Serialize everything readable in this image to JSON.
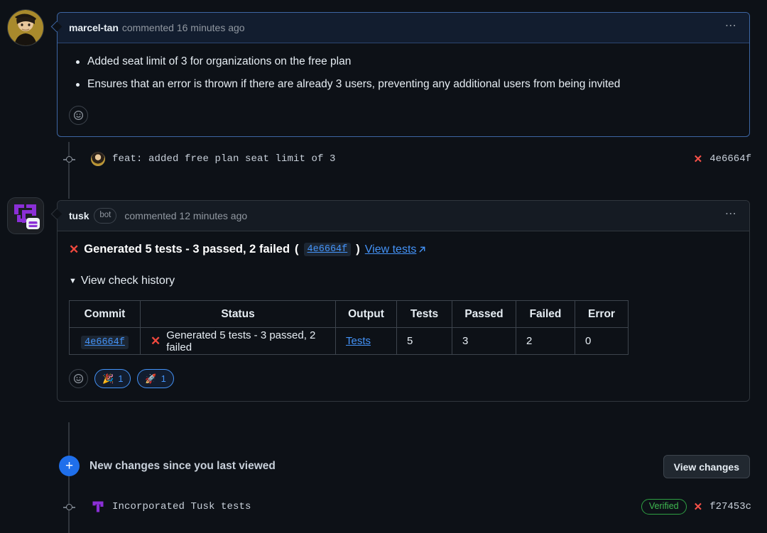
{
  "timeline": {
    "comments": [
      {
        "id": "comment-marcel-tan",
        "author": "marcel-tan",
        "meta": "commented 16 minutes ago",
        "is_author_highlight": true,
        "avatar_icon": "user-avatar",
        "menu_icon": "kebab-menu-icon",
        "bullets": [
          "Added seat limit of 3 for organizations on the free plan",
          "Ensures that an error is thrown if there are already 3 users, preventing any additional users from being invited"
        ],
        "reaction_add_icon": "smiley-plus-icon"
      },
      {
        "id": "comment-tusk-bot",
        "author": "tusk",
        "bot_tag": "bot",
        "meta": "commented 12 minutes ago",
        "is_author_highlight": false,
        "avatar_icon": "tusk-bot-avatar",
        "menu_icon": "kebab-menu-icon",
        "headline": {
          "status_icon": "x-failure-icon",
          "text": "Generated 5 tests - 3 passed, 2 failed",
          "open_paren": "(",
          "commit_sha": "4e6664f",
          "close_paren": ")",
          "link_label": "View tests",
          "link_icon": "external-link-icon"
        },
        "history_toggle": {
          "caret_icon": "caret-down-icon",
          "label": "View check history"
        },
        "reaction_add_icon": "smiley-plus-icon",
        "reactions": [
          {
            "emoji": "🎉",
            "name": "tada-reaction",
            "count": "1"
          },
          {
            "emoji": "🚀",
            "name": "rocket-reaction",
            "count": "1"
          }
        ]
      }
    ],
    "commit_rows": [
      {
        "id": "commit-4e6664f",
        "node_icon": "timeline-node-icon",
        "avatar_icon": "user-avatar",
        "message": "feat: added free plan seat limit of 3",
        "status_icon": "x-failure-icon",
        "sha": "4e6664f",
        "verified": null
      },
      {
        "id": "commit-f27453c",
        "node_icon": "timeline-node-icon",
        "avatar_icon": "tusk-logo-icon",
        "message": "Incorporated Tusk tests",
        "status_icon": "x-failure-icon",
        "sha": "f27453c",
        "verified": "Verified"
      }
    ],
    "new_changes": {
      "badge_icon": "plus-badge-icon",
      "label": "New changes since you last viewed",
      "button_label": "View changes"
    }
  },
  "check_history_table": {
    "headers": [
      "Commit",
      "Status",
      "Output",
      "Tests",
      "Passed",
      "Failed",
      "Error"
    ],
    "rows": [
      {
        "commit": "4e6664f",
        "status_icon": "x-failure-icon",
        "status": "Generated 5 tests - 3 passed, 2 failed",
        "output": "Tests",
        "tests": "5",
        "passed": "3",
        "failed": "2",
        "error": "0"
      }
    ]
  },
  "colors": {
    "page_bg": "#0d1117",
    "author_border": "#3d66a3",
    "plain_border": "#30363d",
    "link": "#4493f8",
    "failure_red": "#f85149",
    "verified_green": "#3fb950",
    "accent_blue": "#1f6feb",
    "tusk_purple": "#8b2fd6"
  }
}
